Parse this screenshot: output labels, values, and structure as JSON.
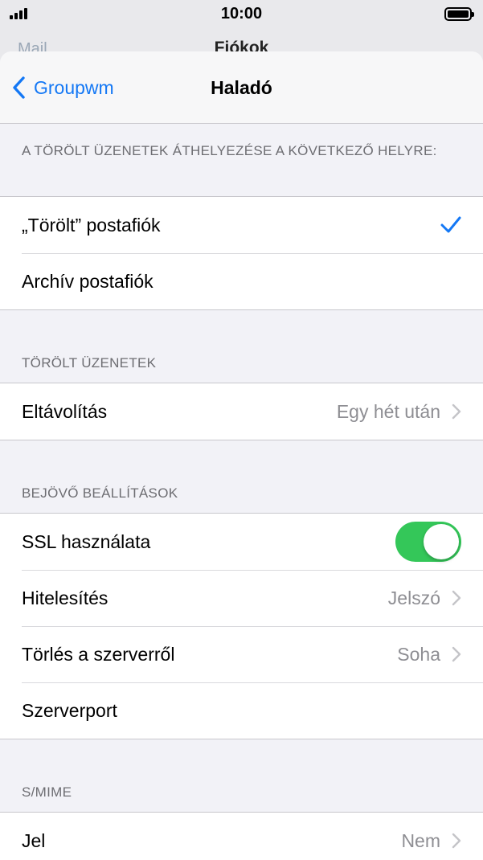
{
  "status": {
    "time": "10:00"
  },
  "background_nav": {
    "back_label": "Mail",
    "title": "Fiókok"
  },
  "nav": {
    "back_label": "Groupwm",
    "title": "Haladó"
  },
  "sections": {
    "move_deleted": {
      "header": "A TÖRÖLT ÜZENETEK ÁTHELYEZÉSE A KÖVETKEZŐ HELYRE:",
      "rows": [
        {
          "label": "„Törölt” postafiók",
          "checked": true
        },
        {
          "label": "Archív postafiók",
          "checked": false
        }
      ]
    },
    "deleted_messages": {
      "header": "TÖRÖLT ÜZENETEK",
      "remove_label": "Eltávolítás",
      "remove_value": "Egy hét után"
    },
    "incoming": {
      "header": "BEJÖVŐ BEÁLLÍTÁSOK",
      "ssl_label": "SSL használata",
      "ssl_on": true,
      "auth_label": "Hitelesítés",
      "auth_value": "Jelszó",
      "delete_label": "Törlés a szerverről",
      "delete_value": "Soha",
      "port_label": "Szerverport"
    },
    "smime": {
      "header": "S/MIME",
      "sign_label": "Jel",
      "sign_value": "Nem"
    }
  },
  "colors": {
    "accent": "#1478f5",
    "toggle_on": "#34c759"
  }
}
